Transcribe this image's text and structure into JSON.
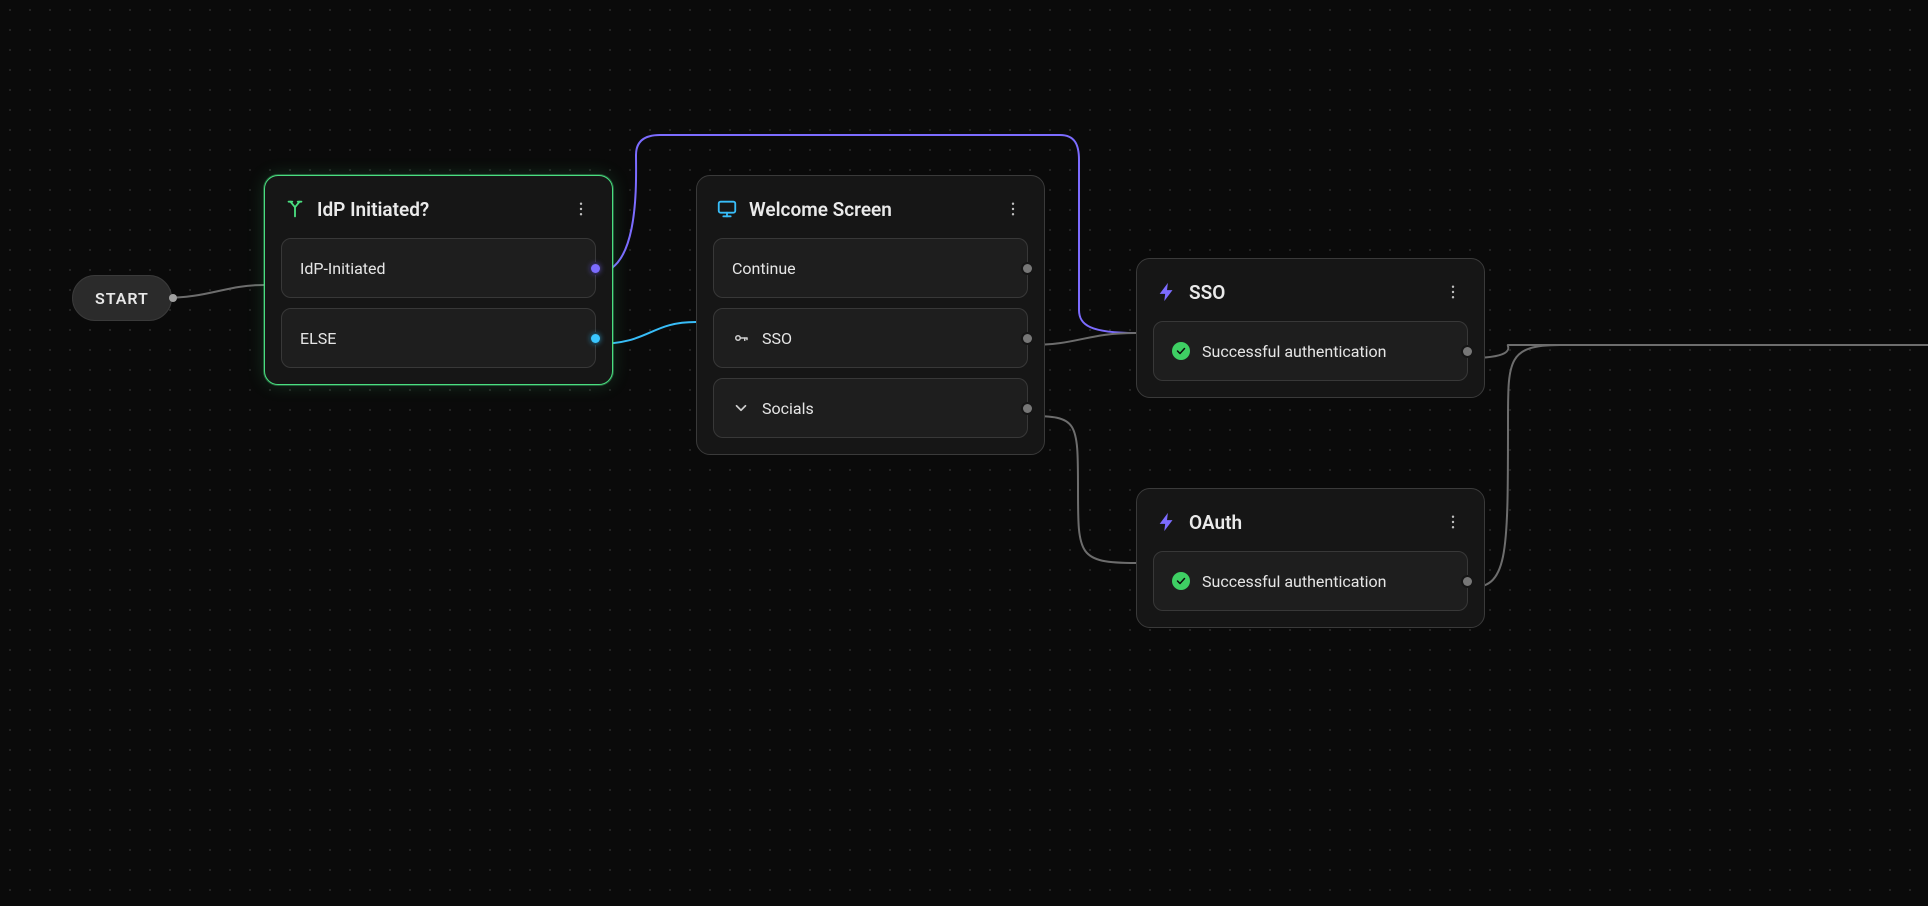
{
  "start": {
    "label": "START"
  },
  "idp": {
    "title": "IdP Initiated?",
    "slots": [
      {
        "label": "IdP-Initiated"
      },
      {
        "label": "ELSE"
      }
    ]
  },
  "welcome": {
    "title": "Welcome Screen",
    "slots": [
      {
        "label": "Continue"
      },
      {
        "label": "SSO"
      },
      {
        "label": "Socials"
      }
    ]
  },
  "sso": {
    "title": "SSO",
    "slots": [
      {
        "label": "Successful authentication"
      }
    ]
  },
  "oauth": {
    "title": "OAuth",
    "slots": [
      {
        "label": "Successful authentication"
      }
    ]
  },
  "colors": {
    "green": "#4ade80",
    "purple": "#7c6cff",
    "blue": "#38bdf8",
    "gray": "#6d6d6d"
  }
}
